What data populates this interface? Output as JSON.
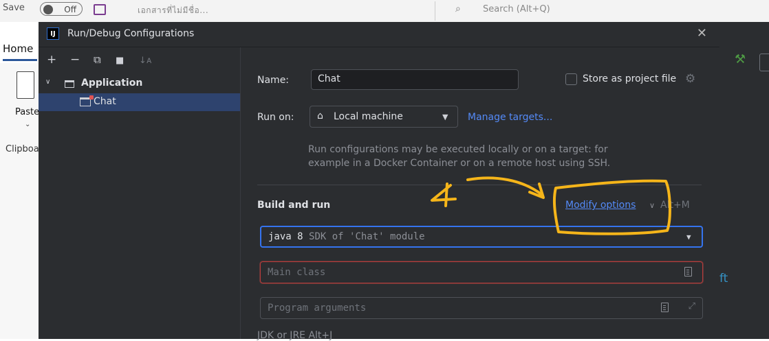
{
  "background": {
    "save_label": "Save",
    "toggle_label": "Off",
    "doc_title": "เอกสารที่ไม่มีชื่อ...",
    "search_placeholder": "Search (Alt+Q)",
    "home_tab": "Home",
    "paste_label": "Paste",
    "clipboard_label": "Clipboard",
    "right_partial_text": "ft"
  },
  "dialog": {
    "title": "Run/Debug Configurations",
    "logo_text": "IJ",
    "close_glyph": "✕"
  },
  "toolbar": {
    "add": "+",
    "remove": "−",
    "copy": "⧉",
    "folder": "■",
    "sort": "↓ᴀ"
  },
  "tree": {
    "group_label": "Application",
    "item_label": "Chat"
  },
  "form": {
    "name_label": "Name:",
    "name_value": "Chat",
    "store_label": "Store as project file",
    "runon_label": "Run on:",
    "runon_value": "Local machine",
    "manage_targets": "Manage targets...",
    "help_line1": "Run configurations may be executed locally or on a target: for",
    "help_line2": "example in a Docker Container or on a remote host using SSH.",
    "build_and_run": "Build and run",
    "modify_options": "Modify options",
    "modify_shortcut": "Alt+M",
    "jdk_value": "java 8",
    "jdk_hint": "SDK of 'Chat' module",
    "main_class_placeholder": "Main class",
    "program_args_placeholder": "Program arguments",
    "bottom_label": "JDK or JRE Alt+J"
  },
  "annotation": {
    "number": "4",
    "color": "#f5b51a"
  },
  "colors": {
    "dialog_bg": "#2b2d30",
    "accent_blue": "#3574f0",
    "link_blue": "#548af7",
    "error_red": "#b63b3b",
    "selected_row": "#2e436e"
  }
}
